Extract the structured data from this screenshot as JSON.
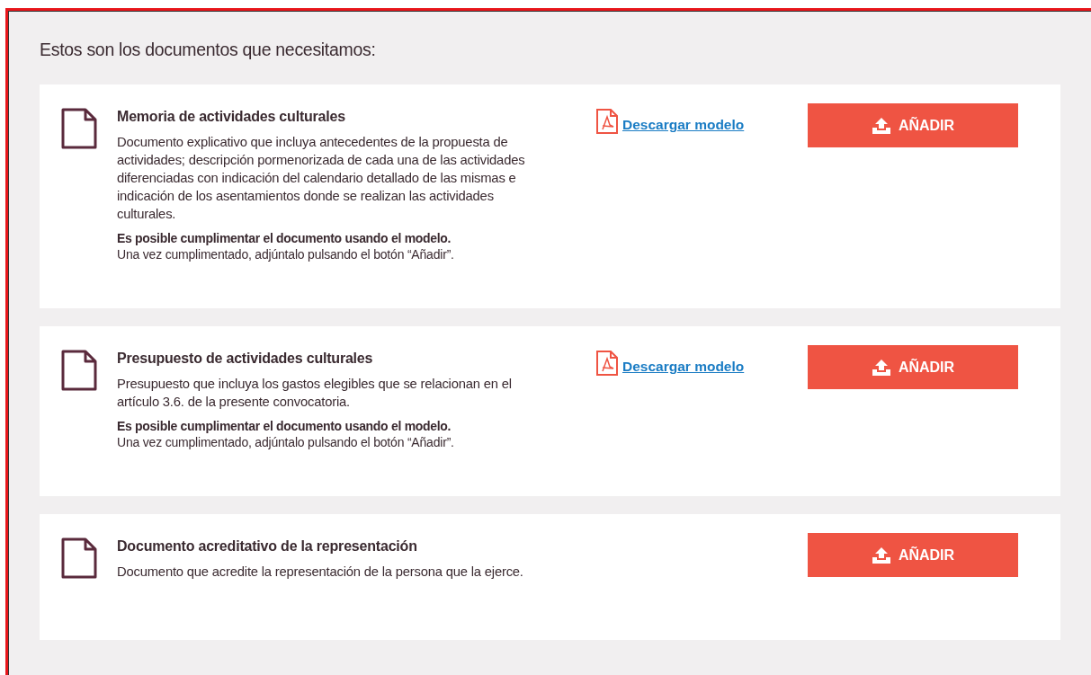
{
  "heading": "Estos son los documentos que necesitamos:",
  "documents": [
    {
      "title": "Memoria de actividades culturales",
      "description": "Documento explicativo que incluya antecedentes de la propuesta de actividades; descripción pormenorizada de cada una de las actividades diferenciadas con indicación del calendario detallado de las mismas e indicación de los asentamientos donde se realizan las actividades culturales.",
      "note_title": "Es posible cumplimentar el documento usando el modelo.",
      "note_text": "Una vez cumplimentado, adjúntalo pulsando el botón “Añadir”.",
      "download_link": "Descargar modelo",
      "button": "AÑADIR"
    },
    {
      "title": "Presupuesto de actividades culturales",
      "description": "Presupuesto que incluya los gastos elegibles que se relacionan en el artículo 3.6. de la presente convocatoria.",
      "note_title": "Es posible cumplimentar el documento usando el modelo.",
      "note_text": "Una vez cumplimentado, adjúntalo pulsando el botón “Añadir”.",
      "download_link": "Descargar modelo",
      "button": "AÑADIR"
    },
    {
      "title": "Documento acreditativo de la representación",
      "description": "Documento que acredite la representación de la persona que la ejerce.",
      "button": "AÑADIR"
    }
  ]
}
